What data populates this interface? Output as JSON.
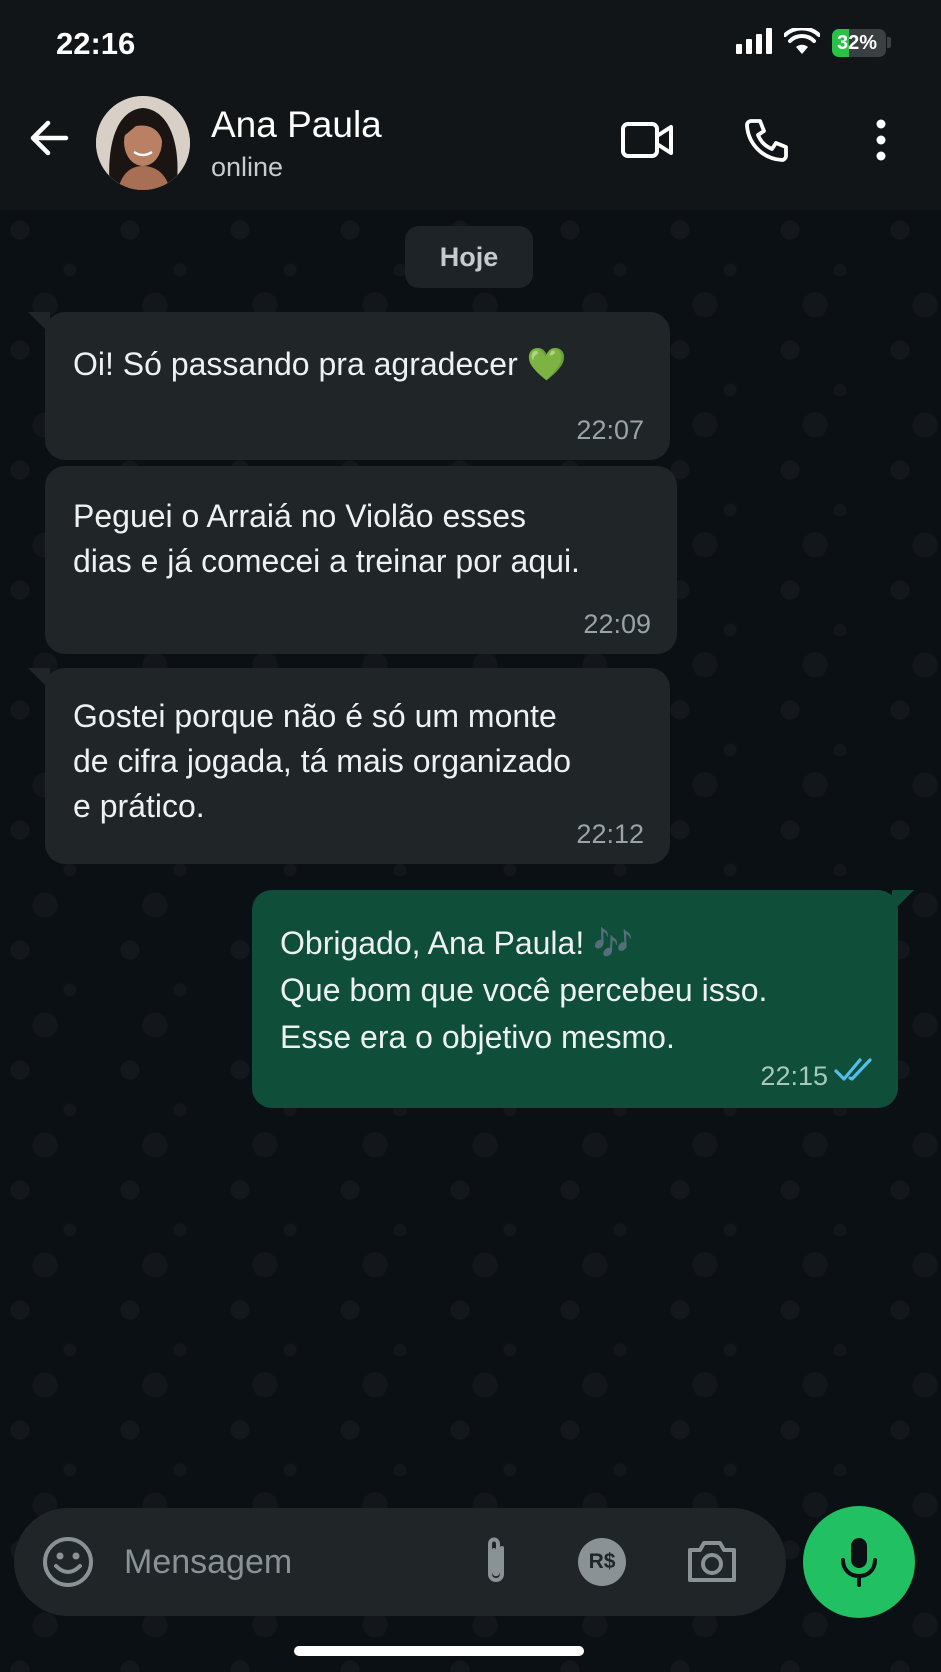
{
  "status_bar": {
    "time": "22:16",
    "battery_percent": "32%",
    "battery_level": 0.32
  },
  "header": {
    "contact_name": "Ana Paula",
    "contact_status": "online",
    "icons": [
      "back-arrow-icon",
      "video-call-icon",
      "phone-icon",
      "more-vertical-icon"
    ]
  },
  "date_separator": "Hoje",
  "messages": [
    {
      "direction": "in",
      "lines": "Oi! Só passando pra agradecer",
      "emoji": "💚",
      "time": "22:07"
    },
    {
      "direction": "in",
      "lines": "Peguei o Arraiá no Violão esses\ndias e já comecei a treinar por aqui.",
      "time": "22:09"
    },
    {
      "direction": "in",
      "lines": "Gostei porque não é só um monte\nde cifra jogada, tá mais organizado\ne prático.",
      "time": "22:12"
    },
    {
      "direction": "out",
      "line1": "Obrigado, Ana Paula!",
      "emoji": "🎶",
      "lines_rest": "Que bom que você percebeu isso.\nEsse era o objetivo mesmo.",
      "time": "22:15",
      "status": "read"
    }
  ],
  "composer": {
    "placeholder": "Mensagem",
    "currency_label": "R$",
    "icons": [
      "emoji-icon",
      "attach-icon",
      "payment-icon",
      "camera-icon",
      "mic-icon"
    ]
  },
  "colors": {
    "background": "#0b1014",
    "incoming_bubble": "#202528",
    "outgoing_bubble": "#0f4e39",
    "accent": "#21c063",
    "read_ticks": "#53bdeb"
  }
}
